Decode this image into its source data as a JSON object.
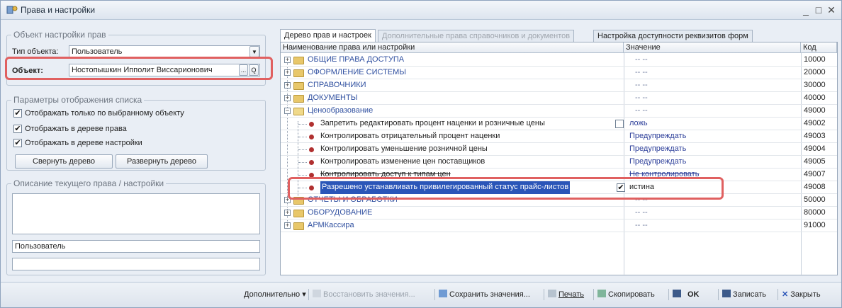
{
  "window": {
    "title": "Права и настройки"
  },
  "left": {
    "object_group_title": "Объект настройки прав",
    "object_type_label": "Тип объекта:",
    "object_type_value": "Пользователь",
    "object_label": "Объект:",
    "object_value": "Ностопышкин Ипполит Виссарионович",
    "object_btn1": "...",
    "object_btn2": "Q",
    "display_group_title": "Параметры отображения списка",
    "checkboxes": [
      {
        "label": "Отображать только по  выбранному объекту",
        "checked": true
      },
      {
        "label": "Отображать в дереве права",
        "checked": true
      },
      {
        "label": "Отображать в дереве настройки",
        "checked": true
      }
    ],
    "collapse_btn": "Свернуть дерево",
    "expand_btn": "Развернуть дерево",
    "desc_group_title": "Описание текущего права / настройки",
    "user_field": "Пользователь"
  },
  "tabs": [
    {
      "label": "Дерево прав и настроек"
    },
    {
      "label": "Дополнительные права справочников и документов"
    },
    {
      "label": "Настройка доступности реквизитов форм"
    }
  ],
  "table": {
    "headers": [
      "Наименование права или настройки",
      "Значение",
      "Код"
    ],
    "rows": [
      {
        "name": "ОБЩИЕ ПРАВА ДОСТУПА",
        "value": "-- --",
        "code": "10000"
      },
      {
        "name": "ОФОРМЛЕНИЕ СИСТЕМЫ",
        "value": "-- --",
        "code": "20000"
      },
      {
        "name": "СПРАВОЧНИКИ",
        "value": "-- --",
        "code": "30000"
      },
      {
        "name": "ДОКУМЕНТЫ",
        "value": "-- --",
        "code": "40000"
      },
      {
        "name": "Ценообразование",
        "value": "-- --",
        "code": "49000"
      },
      {
        "name": "Запретить редактировать процент наценки и розничные цены",
        "value": "ложь",
        "code": "49002"
      },
      {
        "name": "Контролировать отрицательный процент наценки",
        "value": "Предупреждать",
        "code": "49003"
      },
      {
        "name": "Контролировать уменьшение розничной цены",
        "value": "Предупреждать",
        "code": "49004"
      },
      {
        "name": "Контролировать изменение цен поставщиков",
        "value": "Предупреждать",
        "code": "49005"
      },
      {
        "name": "Контролировать доступ к типам цен",
        "value": "Не контролировать",
        "code": "49007"
      },
      {
        "name": "Разрешено устанавливать привилегированный статус прайс-листов",
        "value": "истина",
        "code": "49008"
      },
      {
        "name": "ОТЧЕТЫ И ОБРАБОТКИ",
        "value": "-- --",
        "code": "50000"
      },
      {
        "name": "ОБОРУДОВАНИЕ",
        "value": "-- --",
        "code": "80000"
      },
      {
        "name": "АРМКассира",
        "value": "-- --",
        "code": "91000"
      }
    ]
  },
  "toolbar": {
    "more": "Дополнительно",
    "restore": "Восстановить значения...",
    "save_values": "Сохранить значения...",
    "print": "Печать",
    "copy": "Скопировать",
    "ok": "OK",
    "write": "Записать",
    "close": "Закрыть"
  }
}
